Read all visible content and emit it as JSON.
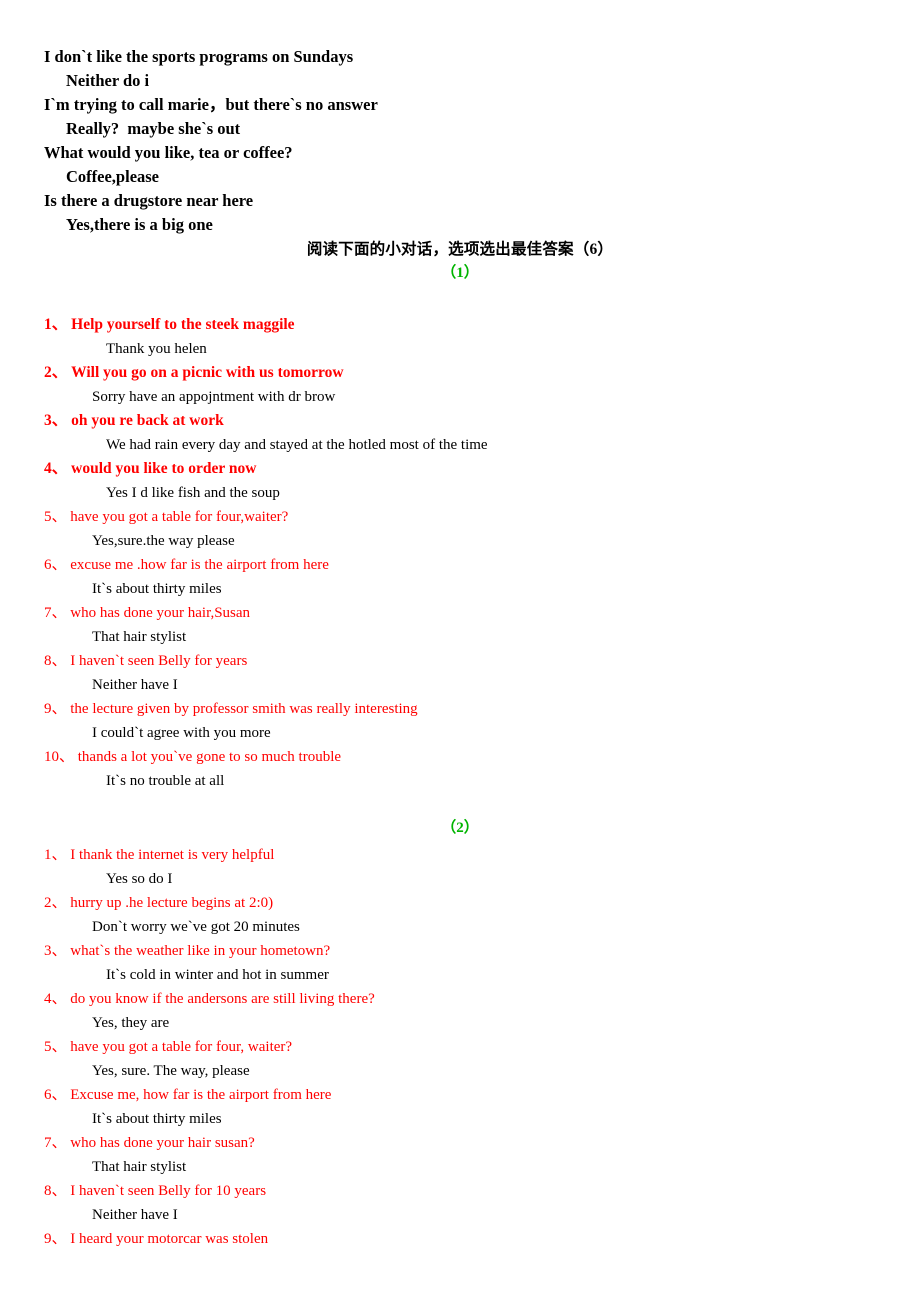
{
  "document": {
    "intro_lines": [
      {
        "text": "I don`t like the sports programs on Sundays",
        "role": "prompt"
      },
      {
        "text": "Neither do i",
        "role": "reply"
      },
      {
        "text": "I`m trying to call marie，but there`s no answer",
        "role": "prompt"
      },
      {
        "text": "Really?  maybe she`s out",
        "role": "reply"
      },
      {
        "text": "What would you like, tea or coffee?",
        "role": "prompt"
      },
      {
        "text": "Coffee,please",
        "role": "reply"
      },
      {
        "text": "Is there a drugstore near here",
        "role": "prompt"
      },
      {
        "text": "Yes,there is a big one",
        "role": "reply"
      }
    ],
    "heading": "阅读下面的小对话，选项选出最佳答案（6）",
    "marker_1": "（1）",
    "marker_2": "（2）",
    "accent_colors": {
      "question_red": "#ff0000",
      "marker_green": "#00b400",
      "answer_black": "#000000"
    },
    "section_1": [
      {
        "number": "1、",
        "question": "Help yourself to the steek maggile",
        "answer": "Thank you helen"
      },
      {
        "number": "2、",
        "question": "Will you go on a picnic with us tomorrow",
        "answer": "Sorry have an appojntment with dr brow"
      },
      {
        "number": "3、",
        "question": "oh you re back at work",
        "answer": "We had rain every day and stayed at the hotled most of the time"
      },
      {
        "number": "4、",
        "question": "would you like to order now",
        "answer": "Yes I d like fish and the soup"
      },
      {
        "number": "5、",
        "question": "have you got a table for four,waiter?",
        "answer": "Yes,sure.the way please"
      },
      {
        "number": "6、",
        "question": "excuse me .how far is the airport from here",
        "answer": "It`s about thirty miles"
      },
      {
        "number": "7、",
        "question": "who has done your hair,Susan",
        "answer": "That hair stylist"
      },
      {
        "number": "8、",
        "question": "I haven`t seen Belly for years",
        "answer": "Neither have I"
      },
      {
        "number": "9、",
        "question": "the lecture given by professor smith was really interesting",
        "answer": "I could`t agree with you more"
      },
      {
        "number": "10、",
        "question": "thands a lot you`ve gone to so much trouble",
        "answer": "It`s no trouble at all"
      }
    ],
    "section_2": [
      {
        "number": "1、",
        "question": "I thank the internet is very helpful",
        "answer": "Yes so do I"
      },
      {
        "number": "2、",
        "question": "hurry up .he lecture begins at 2:0)",
        "answer": "Don`t worry we`ve got 20 minutes"
      },
      {
        "number": "3、",
        "question": "what`s the weather like in your hometown?",
        "answer": "It`s cold in winter and hot in summer"
      },
      {
        "number": "4、",
        "question": "do you know if the andersons are still living there?",
        "answer": "Yes, they are"
      },
      {
        "number": "5、",
        "question": "have you got a table for four, waiter?",
        "answer": "Yes, sure. The way, please"
      },
      {
        "number": "6、",
        "question": "Excuse me, how far is the airport from here",
        "answer": "It`s about thirty miles"
      },
      {
        "number": "7、",
        "question": "who has done your hair susan?",
        "answer": "That hair stylist"
      },
      {
        "number": "8、",
        "question": "I haven`t seen Belly for 10 years",
        "answer": "Neither have I"
      },
      {
        "number": "9、",
        "question": "I heard your motorcar was stolen",
        "answer": ""
      }
    ]
  }
}
